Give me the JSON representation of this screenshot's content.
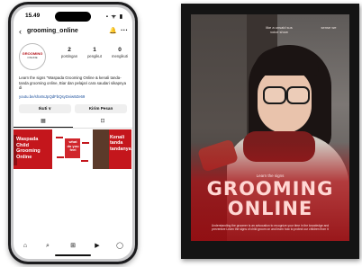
{
  "phone": {
    "status": {
      "time": "15.49",
      "system_icons": "▪ ᯤ ▮"
    },
    "header": {
      "back_icon": "‹",
      "username": "grooming_online",
      "bell_icon": "🔔",
      "more_icon": "···"
    },
    "avatar": {
      "line1": "GROOMING",
      "line2": "ONLINE"
    },
    "stats": [
      {
        "num": "2",
        "label": "postingan"
      },
      {
        "num": "1",
        "label": "pengikut"
      },
      {
        "num": "0",
        "label": "mengikuti"
      }
    ],
    "bio": "Learn the signs \"Waspada Grooming Online & kenali tanda-tanda grooming online, Biar dan pelajari cara saudari sikapnya di",
    "link": "youtu.be/shx8xJpQdFbQsyDviw9Ze69",
    "buttons": {
      "follow": "Ikuti ∨",
      "message": "Kirim Pesan"
    },
    "tabs": {
      "grid_icon": "▦",
      "tagged_icon": "⊡"
    },
    "posts": [
      {
        "text": "Waspada\nChild\nGrooming\nOnline"
      },
      {
        "text": "what\ndo you\nfeel"
      },
      {
        "text": "Kenali\ntanda\ntandanya"
      }
    ],
    "nav": {
      "home_icon": "⌂",
      "search_icon": "⌕",
      "add_icon": "⊞",
      "reels_icon": "▶",
      "profile_icon": "◯"
    }
  },
  "poster": {
    "top_left": "",
    "top_mid": "like a unsaid sus\nvoice show",
    "top_right": "sense we",
    "subtitle": "Learn the signs",
    "title_line1": "GROOMING",
    "title_line2": "ONLINE",
    "description": "Understanding the groomer is an advocation to recognize your time in the knowledge and preventive Learn the signs of child groom on and learn how to protect our children from it"
  }
}
